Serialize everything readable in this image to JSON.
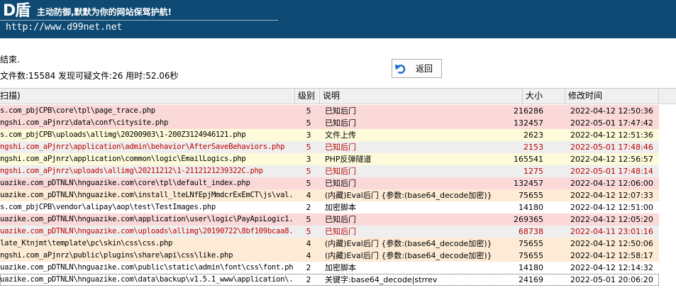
{
  "banner": {
    "logo": "D盾",
    "slogan": "主动防御,默默为你的网站保驾护航!",
    "url": "http://www.d99net.net"
  },
  "status": "结束.",
  "stats": "文件数:15584 发现可疑文件:26 用时:52.06秒",
  "back_button": {
    "label": "返回",
    "icon": "undo-arrow-icon"
  },
  "table": {
    "headers": [
      "扫描)",
      "级别",
      "说明",
      "大小",
      "修改时间"
    ],
    "rows": [
      {
        "path": "s.com_pbjCPB\\core\\tpl\\page_trace.php",
        "level": "5",
        "desc": "已知后门",
        "size": "216286",
        "time": "2022-04-12 12:50:36",
        "bg": "#fcd9d9",
        "red": false
      },
      {
        "path": "ngshi.com_aPjnrz\\data\\conf\\citysite.php",
        "level": "5",
        "desc": "已知后门",
        "size": "132457",
        "time": "2022-05-01 17:47:42",
        "bg": "#fcd9d9",
        "red": false
      },
      {
        "path": "s.com_pbjCPB\\uploads\\allimg\\20200903\\1-200Z3124946121.php",
        "level": "3",
        "desc": "文件上传",
        "size": "2623",
        "time": "2022-04-12 12:51:36",
        "bg": "#fdfbd9",
        "red": false
      },
      {
        "path": "ngshi.com_aPjnrz\\application\\admin\\behavior\\AfterSaveBehaviors.php",
        "level": "5",
        "desc": "已知后门",
        "size": "2153",
        "time": "2022-05-01 17:48:46",
        "bg": "#eeeeee",
        "red": true
      },
      {
        "path": "ngshi.com_aPjnrz\\application\\common\\logic\\EmailLogics.php",
        "level": "3",
        "desc": "PHP反弹隧道",
        "size": "165541",
        "time": "2022-04-12 12:56:57",
        "bg": "#fdfbd9",
        "red": false
      },
      {
        "path": "ngshi.com_aPjnrz\\uploads\\allimg\\20211212\\1-2112121239322C.php",
        "level": "5",
        "desc": "已知后门",
        "size": "1275",
        "time": "2022-05-01 17:48:14",
        "bg": "#eeeeee",
        "red": true
      },
      {
        "path": "uazike.com_pDTNLN\\hnguazike.com\\core\\tpl\\default_index.php",
        "level": "5",
        "desc": "已知后门",
        "size": "132457",
        "time": "2022-04-12 12:06:00",
        "bg": "#fcd9d9",
        "red": false
      },
      {
        "path": "uazike.com_pDTNLN\\hnguazike.com\\install_lteLNfEpjMmdcrExEmCT\\js\\val...",
        "level": "4",
        "desc": "(内藏)Eval后门 {参数:(base64_decode加密)}",
        "size": "75655",
        "time": "2022-04-12 12:07:33",
        "bg": "#fdebd5",
        "red": false
      },
      {
        "path": "s.com_pbjCPB\\vendor\\alipay\\aop\\test\\TestImages.php",
        "level": "2",
        "desc": "加密脚本",
        "size": "14180",
        "time": "2022-04-12 12:51:00",
        "bg": "#ffffff",
        "red": false
      },
      {
        "path": "uazike.com_pDTNLN\\hnguazike.com\\application\\user\\logic\\PayApiLogic1...",
        "level": "5",
        "desc": "已知后门",
        "size": "269365",
        "time": "2022-04-12 12:05:20",
        "bg": "#fcd9d9",
        "red": false
      },
      {
        "path": "uazike.com_pDTNLN\\hnguazike.com\\uploads\\allimg\\20190722\\8bf109bcaa8...",
        "level": "5",
        "desc": "已知后门",
        "size": "68738",
        "time": "2022-04-11 23:01:16",
        "bg": "#eeeeee",
        "red": true
      },
      {
        "path": "late_Ktnjmt\\template\\pc\\skin\\css\\css.php",
        "level": "4",
        "desc": "(内藏)Eval后门 {参数:(base64_decode加密)}",
        "size": "75655",
        "time": "2022-04-12 12:50:06",
        "bg": "#fdebd5",
        "red": false
      },
      {
        "path": "ngshi.com_aPjnrz\\public\\plugins\\share\\api\\css\\like.php",
        "level": "4",
        "desc": "(内藏)Eval后门 {参数:(base64_decode加密)}",
        "size": "75655",
        "time": "2022-04-12 12:58:17",
        "bg": "#fdebd5",
        "red": false
      },
      {
        "path": "uazike.com_pDTNLN\\hnguazike.com\\public\\static\\admin\\font\\css\\font.php",
        "level": "2",
        "desc": "加密脚本",
        "size": "14180",
        "time": "2022-04-12 12:14:32",
        "bg": "#ffffff",
        "red": false
      },
      {
        "path": "uazike.com_pDTNLN\\hnguazike.com\\data\\backup\\v1.5.1_www\\application\\...",
        "level": "2",
        "desc": "关键字:base64_decode|strrev",
        "size": "24169",
        "time": "2022-05-01 20:06:20",
        "bg": "#ffffff",
        "red": false,
        "selected": true
      }
    ]
  }
}
